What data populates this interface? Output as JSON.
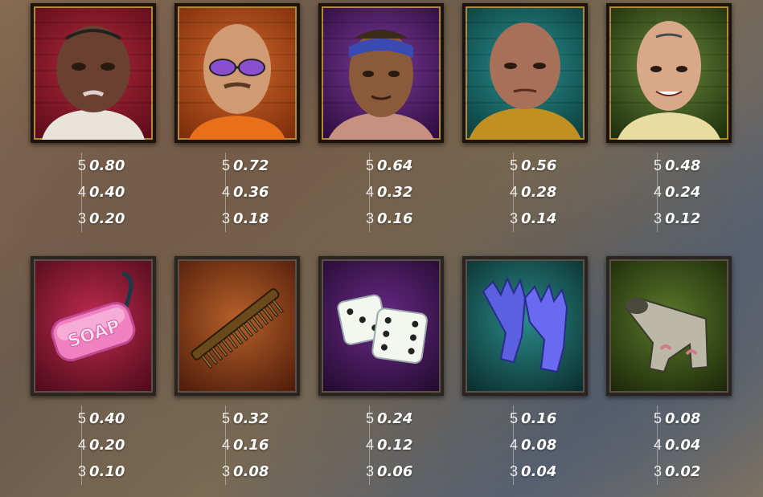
{
  "symbols": [
    {
      "name": "inmate-tattooed-bald",
      "bg": "#7a1020",
      "pays": [
        {
          "count": "5",
          "value": "0.80"
        },
        {
          "count": "4",
          "value": "0.40"
        },
        {
          "count": "3",
          "value": "0.20"
        }
      ]
    },
    {
      "name": "inmate-sunglasses",
      "bg": "#a4431a",
      "pays": [
        {
          "count": "5",
          "value": "0.72"
        },
        {
          "count": "4",
          "value": "0.36"
        },
        {
          "count": "3",
          "value": "0.18"
        }
      ]
    },
    {
      "name": "inmate-bandana",
      "bg": "#4a2060",
      "pays": [
        {
          "count": "5",
          "value": "0.64"
        },
        {
          "count": "4",
          "value": "0.32"
        },
        {
          "count": "3",
          "value": "0.16"
        }
      ]
    },
    {
      "name": "inmate-old-man",
      "bg": "#1f6a6a",
      "pays": [
        {
          "count": "5",
          "value": "0.56"
        },
        {
          "count": "4",
          "value": "0.28"
        },
        {
          "count": "3",
          "value": "0.14"
        }
      ]
    },
    {
      "name": "inmate-lucky-tattoo",
      "bg": "#3f5a24",
      "pays": [
        {
          "count": "5",
          "value": "0.48"
        },
        {
          "count": "4",
          "value": "0.24"
        },
        {
          "count": "3",
          "value": "0.12"
        }
      ]
    },
    {
      "name": "soap",
      "bg": "#8a1530",
      "label": "SOAP",
      "pays": [
        {
          "count": "5",
          "value": "0.40"
        },
        {
          "count": "4",
          "value": "0.20"
        },
        {
          "count": "3",
          "value": "0.10"
        }
      ]
    },
    {
      "name": "comb",
      "bg": "#7a3a1a",
      "pays": [
        {
          "count": "5",
          "value": "0.32"
        },
        {
          "count": "4",
          "value": "0.16"
        },
        {
          "count": "3",
          "value": "0.08"
        }
      ]
    },
    {
      "name": "dice",
      "bg": "#4a1f5a",
      "pays": [
        {
          "count": "5",
          "value": "0.24"
        },
        {
          "count": "4",
          "value": "0.12"
        },
        {
          "count": "3",
          "value": "0.06"
        }
      ]
    },
    {
      "name": "rubber-gloves",
      "bg": "#1a5a5a",
      "pays": [
        {
          "count": "5",
          "value": "0.16"
        },
        {
          "count": "4",
          "value": "0.08"
        },
        {
          "count": "3",
          "value": "0.04"
        }
      ]
    },
    {
      "name": "sock",
      "bg": "#3a4a1c",
      "pays": [
        {
          "count": "5",
          "value": "0.08"
        },
        {
          "count": "4",
          "value": "0.04"
        },
        {
          "count": "3",
          "value": "0.02"
        }
      ]
    }
  ]
}
